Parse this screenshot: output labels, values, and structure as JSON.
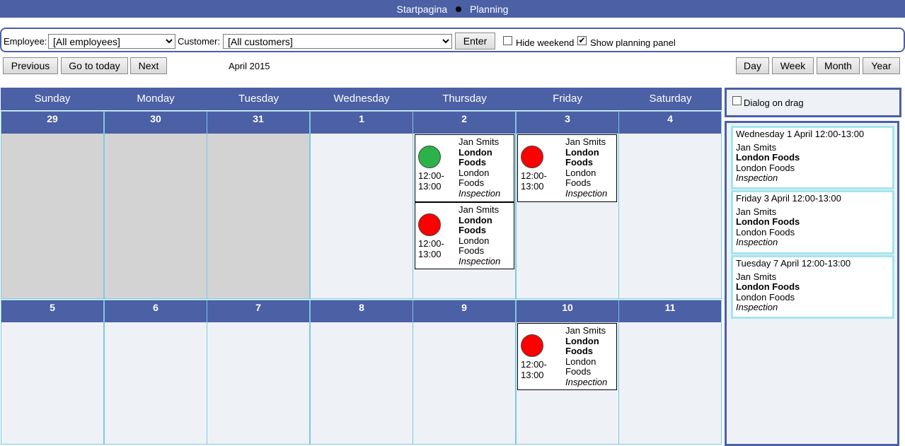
{
  "topbar": {
    "home": "Startpagina",
    "planning": "Planning"
  },
  "filters": {
    "employee_label": "Employee:",
    "employee_value": "[All employees]",
    "customer_label": "Customer:",
    "customer_value": "[All customers]",
    "enter_label": "Enter",
    "hide_weekend_label": "Hide weekend",
    "hide_weekend_checked": false,
    "show_panel_label": "Show planning panel",
    "show_panel_checked": true
  },
  "nav": {
    "previous": "Previous",
    "today": "Go to today",
    "next": "Next",
    "month_label": "April 2015",
    "day": "Day",
    "week": "Week",
    "month": "Month",
    "year": "Year"
  },
  "weekdays": [
    "Sunday",
    "Monday",
    "Tuesday",
    "Wednesday",
    "Thursday",
    "Friday",
    "Saturday"
  ],
  "weeks": [
    [
      "29",
      "30",
      "31",
      "1",
      "2",
      "3",
      "4"
    ],
    [
      "5",
      "6",
      "7",
      "8",
      "9",
      "10",
      "11"
    ]
  ],
  "appointments": [
    {
      "employee": "Jan Smits",
      "customer": "London Foods",
      "location": "London Foods",
      "type": "Inspection",
      "time_start": "12:00-",
      "time_end": "13:00",
      "status": "green"
    },
    {
      "employee": "Jan Smits",
      "customer": "London Foods",
      "location": "London Foods",
      "type": "Inspection",
      "time_start": "12:00-",
      "time_end": "13:00",
      "status": "red"
    },
    {
      "employee": "Jan Smits",
      "customer": "London Foods",
      "location": "London Foods",
      "type": "Inspection",
      "time_start": "12:00-",
      "time_end": "13:00",
      "status": "red"
    },
    {
      "employee": "Jan Smits",
      "customer": "London Foods",
      "location": "London Foods",
      "type": "Inspection",
      "time_start": "12:00-",
      "time_end": "13:00",
      "status": "red"
    }
  ],
  "panel": {
    "dialog_on_drag_label": "Dialog on drag",
    "dialog_on_drag_checked": false,
    "items": [
      {
        "title": "Wednesday 1 April 12:00-13:00",
        "employee": "Jan Smits",
        "customer": "London Foods",
        "location": "London Foods",
        "type": "Inspection"
      },
      {
        "title": "Friday 3 April 12:00-13:00",
        "employee": "Jan Smits",
        "customer": "London Foods",
        "location": "London Foods",
        "type": "Inspection"
      },
      {
        "title": "Tuesday 7 April 12:00-13:00",
        "employee": "Jan Smits",
        "customer": "London Foods",
        "location": "London Foods",
        "type": "Inspection"
      }
    ]
  },
  "colors": {
    "header_blue": "#4b60a5",
    "cell_bg": "#eef2f6",
    "cell_grey": "#d3d3d3",
    "status_red": "#ff0000",
    "status_green": "#2cb24b",
    "panel_border": "#a4e4ee"
  }
}
